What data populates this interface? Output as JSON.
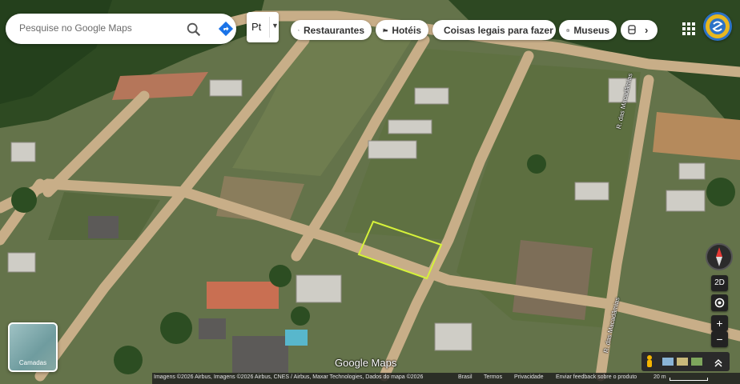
{
  "search": {
    "placeholder": "Pesquise no Google Maps"
  },
  "language": {
    "label": "Pt"
  },
  "chips": [
    {
      "label": "Restaurantes",
      "icon": "restaurant-icon"
    },
    {
      "label": "Hotéis",
      "icon": "hotel-icon"
    },
    {
      "label": "Coisas legais para fazer",
      "icon": "camera-icon"
    },
    {
      "label": "Museus",
      "icon": "museum-icon"
    },
    {
      "label": "",
      "icon": "transit-icon"
    }
  ],
  "layers": {
    "label": "Camadas"
  },
  "controls": {
    "view_mode": "2D",
    "zoom_in": "+",
    "zoom_out": "−"
  },
  "map": {
    "logo": "Google Maps",
    "street_names": [
      "R. das Macadâmias",
      "R. das Macadâmias"
    ]
  },
  "footer": {
    "attribution": "Imagens ©2026 Airbus, Imagens ©2026 Airbus, CNES / Airbus, Maxar Technologies, Dados do mapa ©2026",
    "country": "Brasil",
    "terms": "Termos",
    "privacy": "Privacidade",
    "feedback": "Enviar feedback sobre o produto",
    "scale": "20 m"
  },
  "colors": {
    "highlight": "#d6f23a",
    "accent": "#1a73e8"
  }
}
